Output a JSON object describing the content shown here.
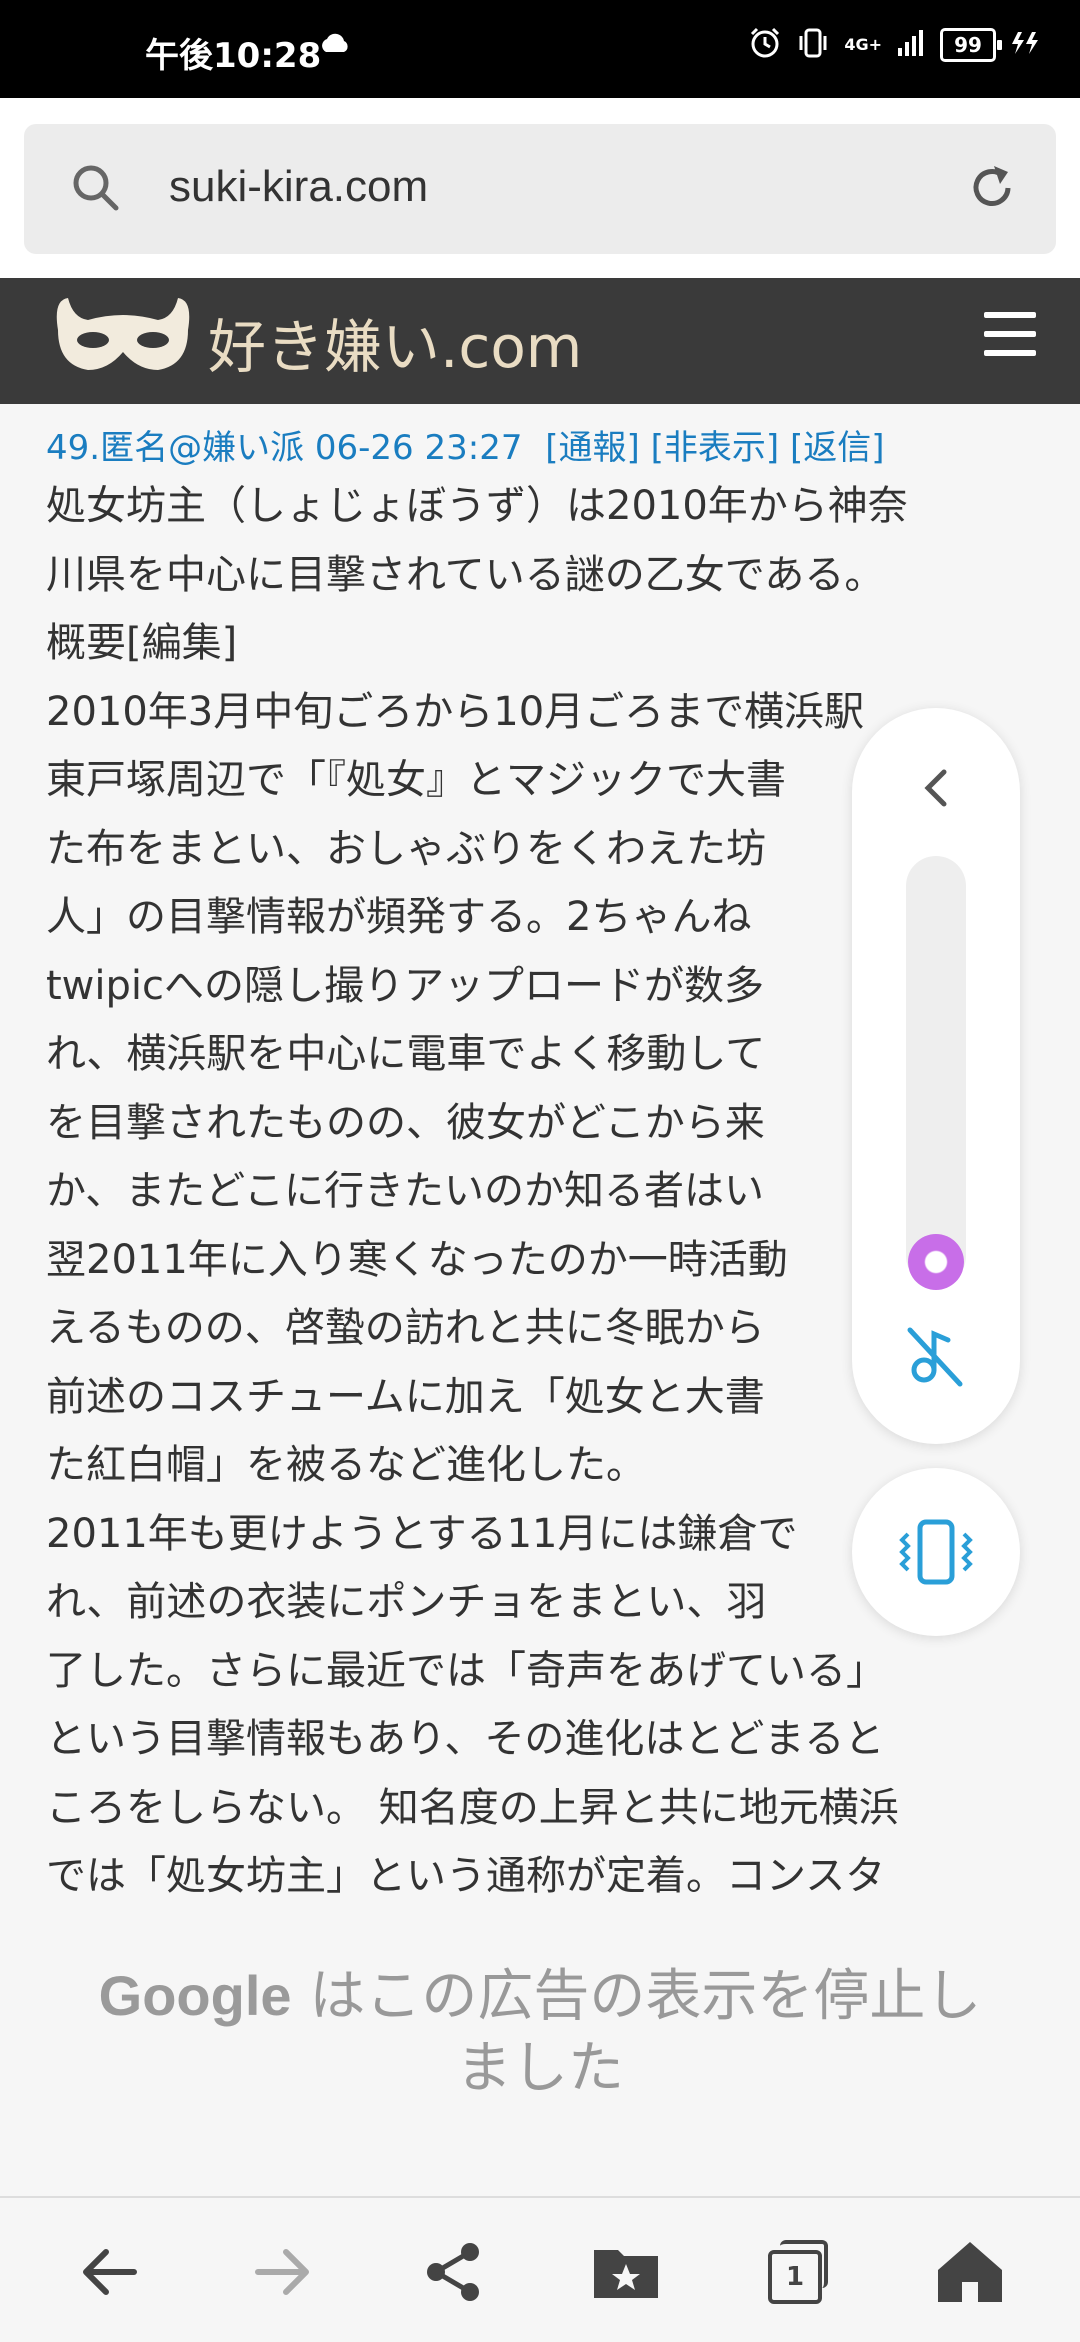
{
  "status_bar": {
    "time": "午後10:28",
    "battery": "99",
    "network": "4G+"
  },
  "address_bar": {
    "url": "suki-kira.com"
  },
  "site": {
    "logo_text": "好き嫌い.com"
  },
  "comment": {
    "meta": "49.匿名@嫌い派 06-26 23:27",
    "actions": [
      "[通報]",
      "[非表示]",
      "[返信]"
    ],
    "lines": [
      "処女坊主（しょじょぼうず）は2010年から神奈",
      "川県を中心に目撃されている謎の乙女である。",
      "概要[編集]",
      "2010年3月中旬ごろから10月ごろまで横浜駅",
      "東戸塚周辺で「『処女』とマジックで大書",
      "た布をまとい、おしゃぶりをくわえた坊",
      "人」の目撃情報が頻発する。2ちゃんね",
      "twipicへの隠し撮りアップロードが数多",
      "れ、横浜駅を中心に電車でよく移動して",
      "を目撃されたものの、彼女がどこから来",
      "か、またどこに行きたいのか知る者はい",
      "翌2011年に入り寒くなったのか一時活動",
      "えるものの、啓蟄の訪れと共に冬眠から",
      "前述のコスチュームに加え「処女と大書",
      "た紅白帽」を被るなど進化した。",
      "2011年も更けようとする11月には鎌倉で",
      "れ、前述の衣装にポンチョをまとい、羽",
      "了した。さらに最近では「奇声をあげている」",
      "という目撃情報もあり、その進化はとどまると",
      "ころをしらない。 知名度の上昇と共に地元横浜",
      "では「処女坊主」という通称が定着。コンスタ"
    ]
  },
  "ad": {
    "brand": "Google",
    "message_line1": " はこの広告の表示を停止し",
    "message_line2": "ました"
  },
  "colors": {
    "link": "#1a7dc0",
    "header_bg": "#3a3a3a",
    "slider_knob": "#c86ee8",
    "accent_icon": "#2a9fd8"
  }
}
